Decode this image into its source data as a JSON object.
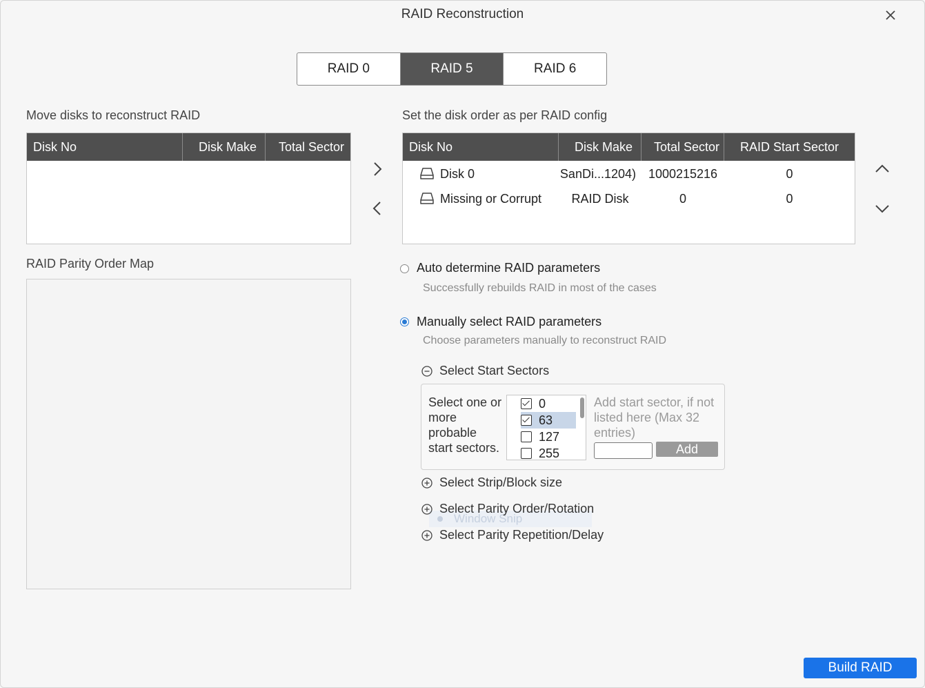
{
  "dialog": {
    "title": "RAID Reconstruction"
  },
  "raid_tabs": [
    {
      "label": "RAID 0",
      "active": false
    },
    {
      "label": "RAID 5",
      "active": true
    },
    {
      "label": "RAID 6",
      "active": false
    }
  ],
  "left_table": {
    "label": "Move disks to reconstruct RAID",
    "headers": [
      "Disk No",
      "Disk Make",
      "Total Sector"
    ],
    "rows": []
  },
  "right_table": {
    "label": "Set the disk order as per RAID config",
    "headers": [
      "Disk No",
      "Disk Make",
      "Total Sector",
      "RAID Start Sector"
    ],
    "rows": [
      {
        "disk_no": "Disk 0",
        "disk_make": "SanDi...1204)",
        "total_sector": "1000215216",
        "raid_start": "0"
      },
      {
        "disk_no": "Missing or Corrupt",
        "disk_make": "RAID Disk",
        "total_sector": "0",
        "raid_start": "0"
      }
    ]
  },
  "parity_map": {
    "label": "RAID Parity Order Map"
  },
  "options": {
    "auto": {
      "label": "Auto determine RAID parameters",
      "description": "Successfully rebuilds RAID in most of the cases",
      "selected": false
    },
    "manual": {
      "label": "Manually select RAID parameters",
      "description": "Choose parameters manually to reconstruct RAID",
      "selected": true
    }
  },
  "start_sectors": {
    "header": "Select Start Sectors",
    "prompt_lines": [
      "Select one or",
      "more",
      "probable",
      "start sectors."
    ],
    "items": [
      {
        "value": "0",
        "checked": true
      },
      {
        "value": "63",
        "checked": true
      },
      {
        "value": "127",
        "checked": false
      },
      {
        "value": "255",
        "checked": false
      }
    ],
    "hint_lines": [
      "Add start sector, if not",
      "listed here (Max 32",
      "entries)"
    ],
    "add_input_value": "",
    "add_label": "Add"
  },
  "sections": {
    "strip": "Select Strip/Block size",
    "parity_order": "Select Parity Order/Rotation",
    "parity_repetition": "Select Parity Repetition/Delay"
  },
  "ghost_tooltip": "Window Snip",
  "build_label": "Build RAID",
  "colors": {
    "accent": "#1a73e8",
    "table_header": "#4f4f4f",
    "active_tab": "#555555",
    "radio_selected": "#2a7bd4",
    "selected_item": "#c8d6e8"
  },
  "icons": {
    "close": "close-icon",
    "move_right": "chevron-right-icon",
    "move_left": "chevron-left-icon",
    "move_up": "chevron-up-icon",
    "move_down": "chevron-down-icon",
    "disk": "disk-drive-icon",
    "collapse": "minus-circle-icon",
    "expand": "plus-circle-icon"
  }
}
